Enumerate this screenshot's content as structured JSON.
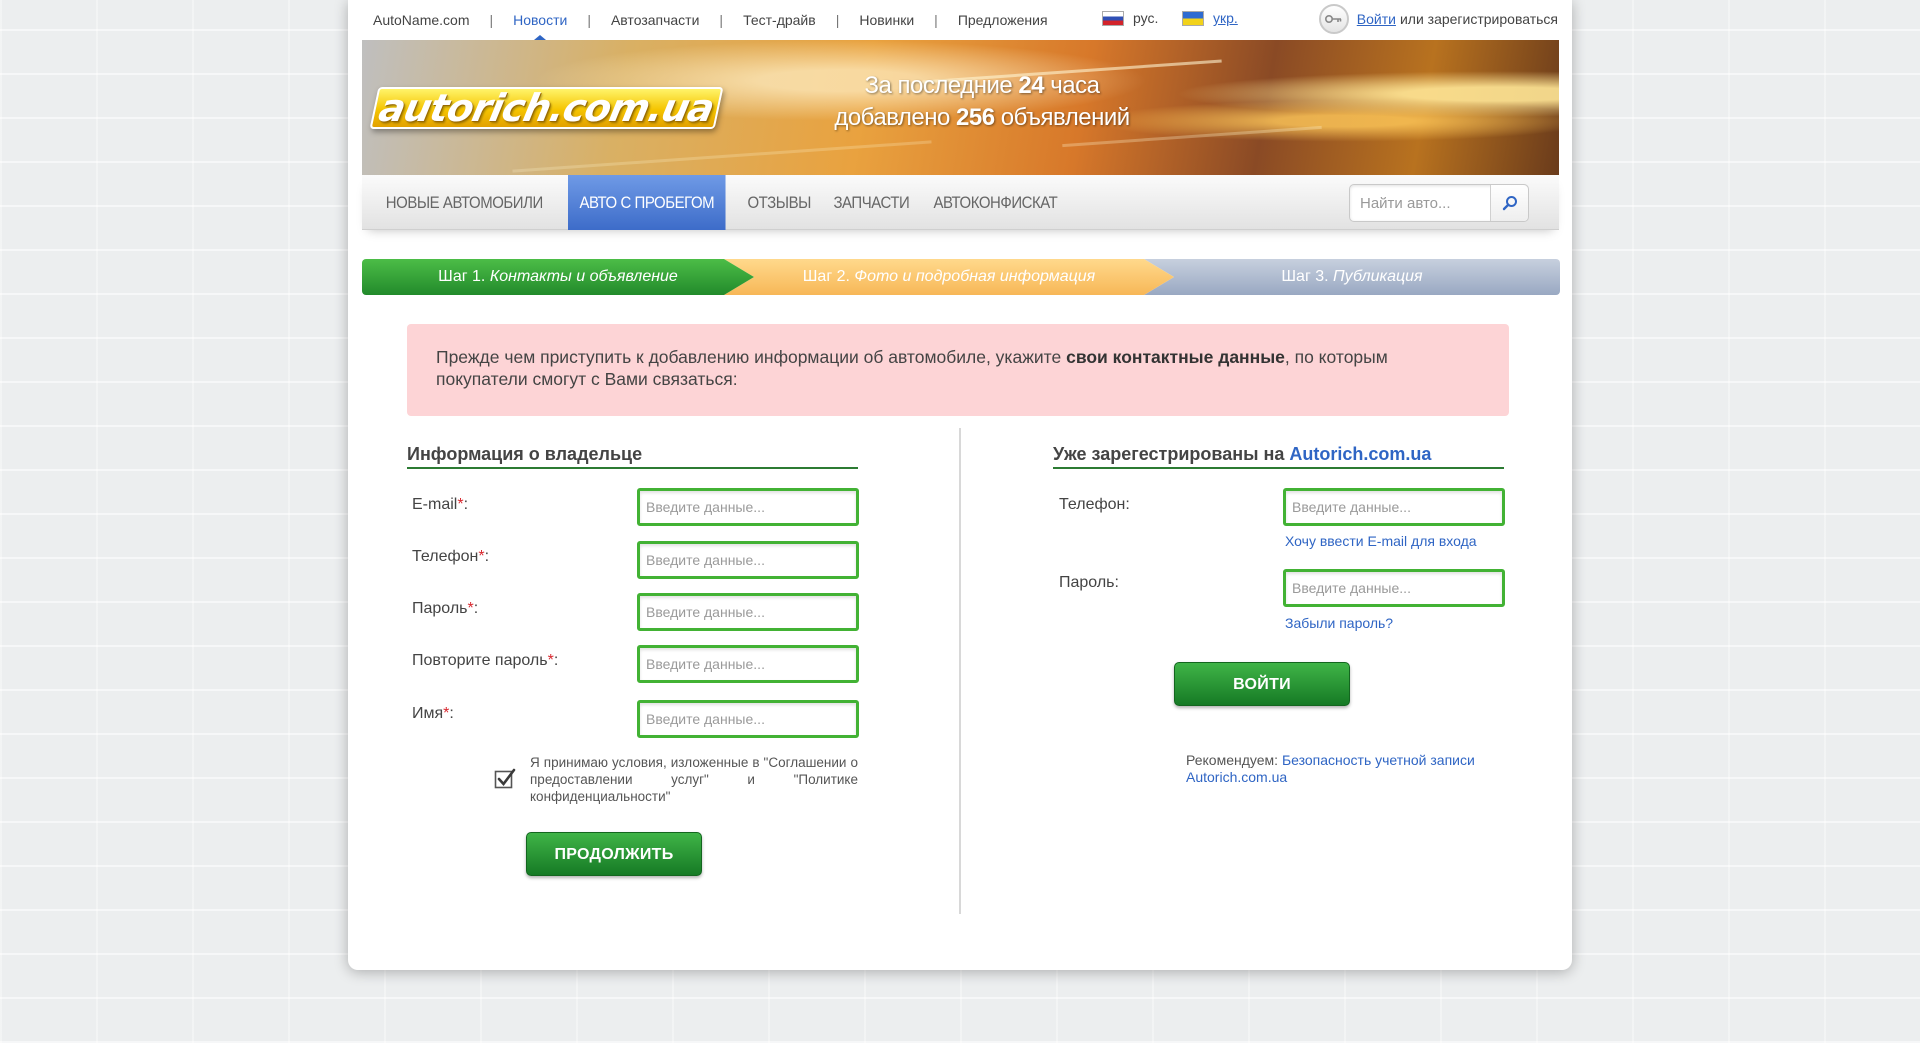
{
  "topbar": {
    "nav": [
      "AutoName.com",
      "Новости",
      "Автозапчасти",
      "Тест-драйв",
      "Новинки",
      "Предложения"
    ],
    "active_index": 1,
    "lang_ru": "рус.",
    "lang_ua": "укр.",
    "login_link": "Войти",
    "register_text": "или зарегистрироваться"
  },
  "banner": {
    "logo_text": "autorich.com.ua",
    "line1_prefix": "За последние",
    "line1_number": "24",
    "line1_suffix": "часа",
    "line2_prefix": "добавлено",
    "line2_number": "256",
    "line2_suffix": "объявлений"
  },
  "mainnav": {
    "items": [
      "НОВЫЕ АВТОМОБИЛИ",
      "АВТО С ПРОБЕГОМ",
      "ОТЗЫВЫ",
      "ЗАПЧАСТИ",
      "АВТОКОНФИСКАТ"
    ],
    "active_index": 1,
    "search_placeholder": "Найти авто..."
  },
  "steps": [
    {
      "prefix": "Шаг 1.",
      "label": "Контакты и объявление"
    },
    {
      "prefix": "Шаг 2.",
      "label": "Фото и подробная информация"
    },
    {
      "prefix": "Шаг 3.",
      "label": "Публикация"
    }
  ],
  "notice": {
    "text_before": "Прежде чем приступить к добавлению информации об автомобиле, укажите ",
    "text_bold": "свои контактные данные",
    "text_after": ", по которым покупатели смогут с Вами связаться:"
  },
  "owner_form": {
    "title": "Информация о владельце",
    "fields": [
      {
        "label": "E-mail",
        "placeholder": "Введите данные..."
      },
      {
        "label": "Телефон",
        "placeholder": "Введите данные..."
      },
      {
        "label": "Пароль",
        "placeholder": "Введите данные..."
      },
      {
        "label": "Повторите пароль",
        "placeholder": "Введите данные..."
      },
      {
        "label": "Имя",
        "placeholder": "Введите данные..."
      }
    ],
    "required_mark": "*",
    "colon": ":",
    "terms": "Я принимаю условия, изложенные в \"Соглашении о предоставлении услуг\" и \"Политике конфиденциальности\"",
    "continue_button": "ПРОДОЛЖИТЬ"
  },
  "login_form": {
    "title_prefix": "Уже зарегестрированы на",
    "title_link": "Autorich.com.ua",
    "phone_label": "Телефон:",
    "phone_placeholder": "Введите данные...",
    "email_link": "Хочу ввести E-mail для входа",
    "password_label": "Пароль:",
    "password_placeholder": "Введите данные...",
    "forgot_link": "Забыли пароль?",
    "login_button": "ВОЙТИ",
    "recommend_prefix": "Рекомендуем:",
    "recommend_link": "Безопасность учетной записи Autorich.com.ua"
  },
  "colors": {
    "accent_blue": "#2f65c4",
    "green": "#42b234",
    "notice_bg": "#fdd4d6",
    "required_red": "#d8262d"
  }
}
